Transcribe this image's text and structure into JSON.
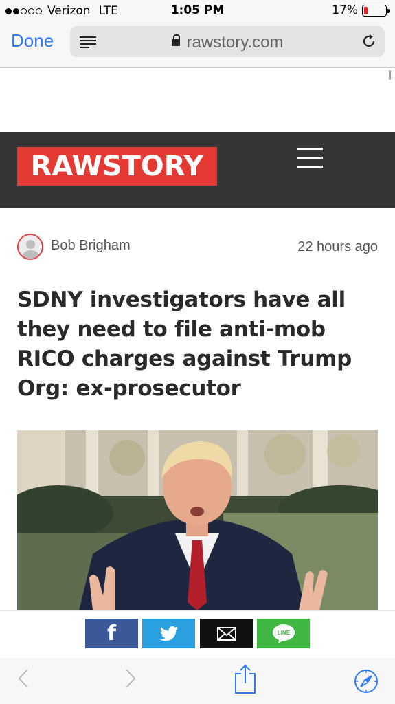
{
  "status_bar": {
    "carrier": "Verizon",
    "network": "LTE",
    "time": "1:05 PM",
    "battery_percent": "17%",
    "battery_level": 0.17,
    "signal_bars_filled": 2,
    "signal_bars_total": 5
  },
  "browser": {
    "done_label": "Done",
    "url": "rawstory.com"
  },
  "site": {
    "logo_text": "RAWSTORY",
    "brand_color": "#e53a34",
    "header_color": "#353535"
  },
  "article": {
    "author": "Bob Brigham",
    "time_ago": "22 hours ago",
    "headline": "SDNY investigators have all they need to file anti-mob RICO charges against Trump Org: ex-prosecutor"
  },
  "share_buttons": [
    {
      "name": "facebook",
      "icon": "facebook-icon",
      "color": "#3b5998"
    },
    {
      "name": "twitter",
      "icon": "twitter-bird-icon",
      "color": "#2a9fe0"
    },
    {
      "name": "email",
      "icon": "envelope-icon",
      "color": "#111111"
    },
    {
      "name": "line",
      "icon": "line-icon",
      "label": "LINE",
      "color": "#3fb742"
    }
  ],
  "toolbar": {
    "back_enabled": false,
    "forward_enabled": false
  }
}
